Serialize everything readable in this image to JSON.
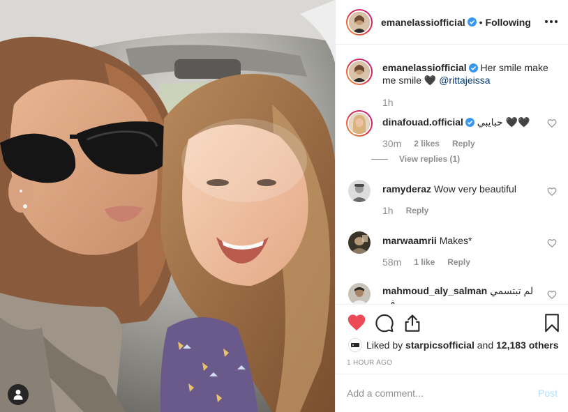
{
  "post": {
    "username": "emanelassiofficial",
    "separator": "•",
    "follow_status": "Following",
    "caption": {
      "username": "emanelassiofficial",
      "text": "Her smile make me smile 🖤 ",
      "mention": "@rittajeissa",
      "time": "1h"
    }
  },
  "comments": [
    {
      "username": "dinafouad.official",
      "verified": true,
      "text": "حبايبي 🖤🖤",
      "time": "30m",
      "likes": "2 likes",
      "reply": "Reply",
      "view_replies": "View replies (1)"
    },
    {
      "username": "ramyderaz",
      "verified": false,
      "text": "Wow very beautiful",
      "time": "1h",
      "reply": "Reply"
    },
    {
      "username": "marwaamrii",
      "verified": false,
      "text": "Makes*",
      "time": "58m",
      "likes": "1 like",
      "reply": "Reply"
    },
    {
      "username": "mahmoud_aly_salman",
      "verified": false,
      "text": "لم تبتسمي في",
      "text_line2": "\""
    }
  ],
  "likes": {
    "prefix": "Liked by ",
    "liked_by": "starpicsofficial",
    "middle": " and ",
    "others": "12,183 others"
  },
  "time_ago": "1 HOUR AGO",
  "add_comment": {
    "placeholder": "Add a comment...",
    "post_label": "Post"
  },
  "colors": {
    "heart_liked": "#ed4956",
    "verified_badge": "#3897f0",
    "post_disabled": "#b2dffc",
    "meta_gray": "#8e8e8e"
  }
}
